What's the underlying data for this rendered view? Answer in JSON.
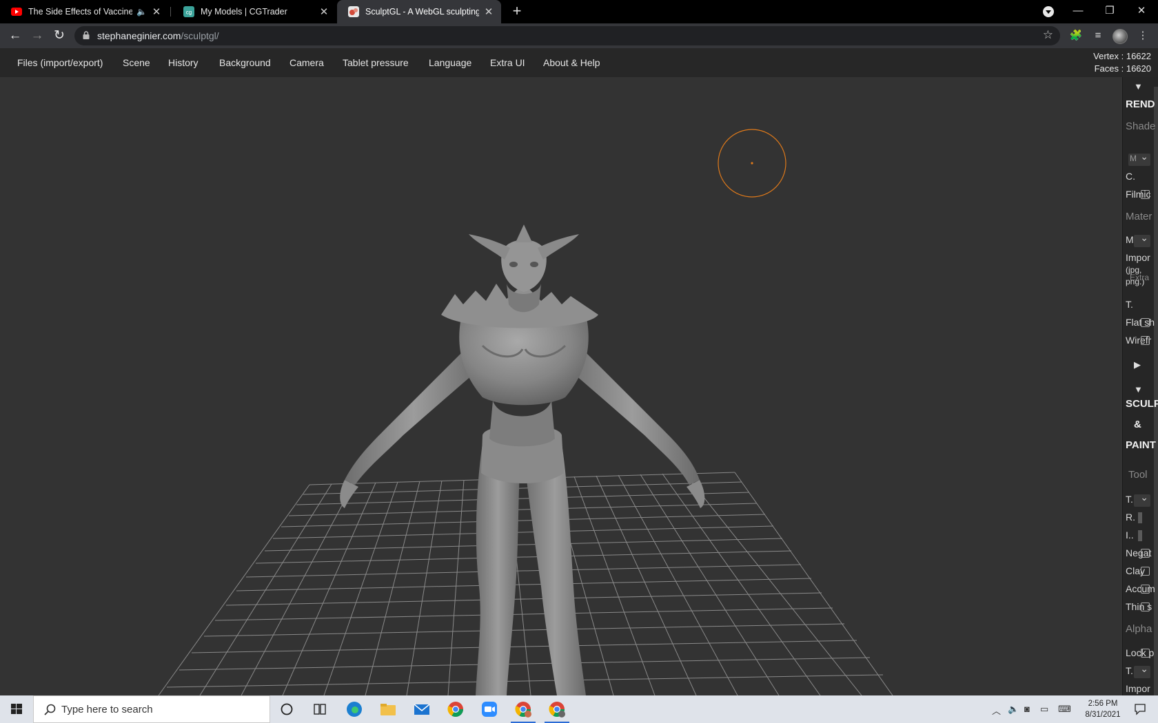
{
  "browser": {
    "tabs": [
      {
        "title": "The Side Effects of Vaccines",
        "favicon": "youtube-icon",
        "muted": true,
        "active": false
      },
      {
        "title": "My Models | CGTrader",
        "favicon": "cgtrader-icon",
        "active": false
      },
      {
        "title": "SculptGL - A WebGL sculpting ap",
        "favicon": "sculptgl-icon",
        "active": true
      }
    ],
    "address": {
      "host": "stephaneginier.com",
      "path": "/sculptgl/"
    }
  },
  "app": {
    "menu": [
      "Files (import/export)",
      "Scene",
      "History",
      "Background",
      "Camera",
      "Tablet pressure",
      "Language",
      "Extra UI",
      "About & Help"
    ],
    "stats": {
      "vertex": "Vertex : 16622",
      "faces": "Faces : 16620"
    }
  },
  "panel": {
    "rendering_header": "REND",
    "shader_label": "Shade",
    "shader_select": "M",
    "row_c": "C.",
    "filmic_label": "Filmic",
    "material_label": "Mater",
    "material_select": "M",
    "import_label": "Impor",
    "import_ext": "(jpg,",
    "import_ext2": "png.)",
    "extra_label": "Extra",
    "row_t": "T.",
    "flat_label": "Flat sh",
    "wire_label": "Wirefr",
    "collapsed_arrow": "▶",
    "expand_arrow": "▼",
    "sculpt_header_1": "SCULP",
    "sculpt_header_2": "&",
    "sculpt_header_3": "PAINT",
    "tool_label": "Tool",
    "tool_select": "T.",
    "radius_label": "R.",
    "intensity_label": "I..",
    "negative_label": "Negat",
    "clay_label": "Clay",
    "accumulate_label": "Accum",
    "thin_label": "Thin s",
    "alpha_label": "Alpha",
    "lock_label": "Lock p",
    "alpha_select": "T.",
    "alpha_import": "Impor"
  },
  "taskbar": {
    "search_placeholder": "Type here to search",
    "time": "2:56 PM",
    "date": "8/31/2021"
  },
  "colors": {
    "viewport_bg": "#333333",
    "brush_ring": "#e07a1a",
    "model": "#8c8c8c",
    "grid": "#9a9a9a"
  }
}
